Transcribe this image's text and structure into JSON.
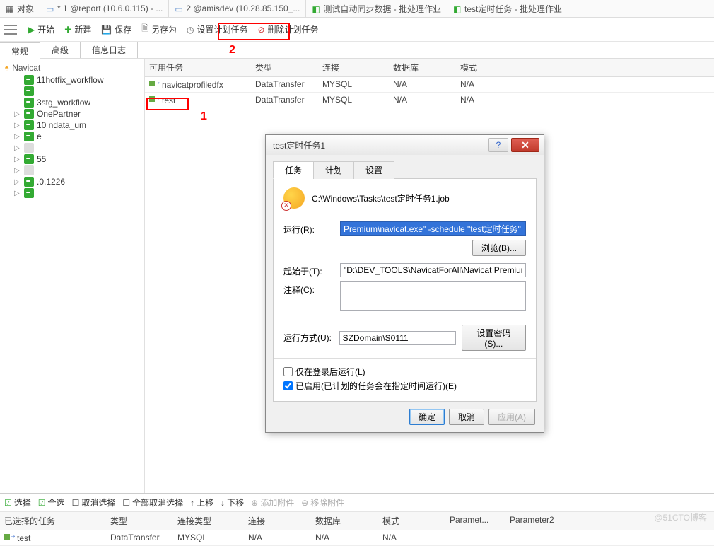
{
  "top_tabs": {
    "t0": "对象",
    "t1": "* 1 @report (10.6.0.115) - ...",
    "t2": "2 @amisdev (10.28.85.150_...",
    "t3": "测试自动同步数据 - 批处理作业",
    "t4": "test定时任务 - 批处理作业"
  },
  "toolbar": {
    "start": "开始",
    "new": "新建",
    "save": "保存",
    "save_as": "另存为",
    "set_schedule": "设置计划任务",
    "delete_schedule": "删除计划任务"
  },
  "annotations": {
    "one": "1",
    "two": "2"
  },
  "sub_tabs": {
    "general": "常规",
    "advanced": "高级",
    "log": "信息日志"
  },
  "sidebar": {
    "root": "Navicat",
    "items": [
      "11hotfix_workflow",
      "",
      "3stg_workflow",
      "OnePartner",
      "10                        ndata_um",
      "                         e",
      "",
      "                         55",
      "",
      "      .0.1226",
      ""
    ]
  },
  "grid": {
    "headers": {
      "task": "可用任务",
      "type": "类型",
      "conn": "连接",
      "db": "数据库",
      "mode": "模式"
    },
    "rows": [
      {
        "task": "navicatprofiledfx",
        "type": "DataTransfer",
        "conn": "MYSQL",
        "db": "N/A",
        "mode": "N/A"
      },
      {
        "task": "test",
        "type": "DataTransfer",
        "conn": "MYSQL",
        "db": "N/A",
        "mode": "N/A"
      }
    ]
  },
  "bottom_toolbar": {
    "select": "选择",
    "select_all": "全选",
    "deselect": "取消选择",
    "deselect_all": "全部取消选择",
    "move_up": "上移",
    "move_down": "下移",
    "add_attach": "添加附件",
    "remove_attach": "移除附件"
  },
  "bottom_grid": {
    "headers": {
      "task": "已选择的任务",
      "type": "类型",
      "conn_type": "连接类型",
      "conn": "连接",
      "db": "数据库",
      "mode": "模式",
      "p1": "Paramet...",
      "p2": "Parameter2"
    },
    "row": {
      "task": "test",
      "type": "DataTransfer",
      "conn_type": "MYSQL",
      "conn": "N/A",
      "db": "N/A",
      "mode": "N/A"
    }
  },
  "dialog": {
    "title": "test定时任务1",
    "tabs": {
      "task": "任务",
      "schedule": "计划",
      "settings": "设置"
    },
    "job_path": "C:\\Windows\\Tasks\\test定时任务1.job",
    "run_label": "运行(R):",
    "run_value": "Premium\\navicat.exe\" -schedule \"test定时任务\"",
    "browse": "浏览(B)...",
    "start_in_label": "起始于(T):",
    "start_in_value": "\"D:\\DEV_TOOLS\\NavicatForAll\\Navicat Premium\\\"",
    "comment_label": "注释(C):",
    "run_as_label": "运行方式(U):",
    "run_as_value": "SZDomain\\S0111",
    "set_password": "设置密码(S)...",
    "only_logged_on": "仅在登录后运行(L)",
    "enabled": "已启用(已计划的任务会在指定时间运行)(E)",
    "ok": "确定",
    "cancel": "取消",
    "apply": "应用(A)"
  },
  "watermark": "@51CTO博客"
}
